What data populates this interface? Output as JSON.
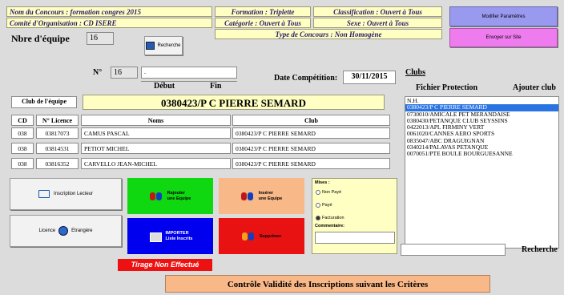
{
  "info": {
    "concours": "Nom du Concours : formation  congres  2015",
    "comite": "Comité d'Organisation : CD ISERE",
    "formation": "Formation : Triplette",
    "categorie": "Catégorie : Ouvert à Tous",
    "classification": "Classification : Ouvert à Tous",
    "sexe": "Sexe : Ouvert à Tous",
    "type": "Type de Concours : Non Homogène"
  },
  "buttons": {
    "modifier": "Modifier Paramètres",
    "envoyer": "Envoyer sur Site",
    "recherche_small": "Recherche",
    "inscription": "Inscription Lecteur",
    "licence": "Licence",
    "etrangere": "Etrangère",
    "rajouter": [
      "Rajouter",
      "une Equipe"
    ],
    "inserer": [
      "Insérer",
      "une Equipe"
    ],
    "importer": [
      "IMPORTER",
      "Liste Inscrits"
    ],
    "supprimer": "Supprimer",
    "fichier_protection": "Fichier Protection",
    "ajouter_club": "Ajouter club",
    "recherche": "Recherche",
    "controle": "Contrôle Validité des Inscriptions suivant les Critères"
  },
  "nbre": {
    "label": "Nbre d'équipe",
    "value": "16"
  },
  "numero": {
    "label": "N°",
    "value": "16",
    "debut": "Début",
    "fin": "Fin",
    "field": "."
  },
  "competition": {
    "label": "Date Compétition:",
    "value": "30/11/2015"
  },
  "team": {
    "club_label": "Club de l'équipe",
    "club_name": "0380423/P C PIERRE SEMARD"
  },
  "table": {
    "headers": [
      "CD",
      "N° Licence",
      "Noms",
      "Club"
    ],
    "rows": [
      [
        "038",
        "03817073",
        "CAMUS PASCAL",
        "0380423/P C PIERRE SEMARD"
      ],
      [
        "038",
        "03814531",
        "PETIOT MICHEL",
        "0380423/P C PIERRE SEMARD"
      ],
      [
        "038",
        "03816352",
        "CARVELLO JEAN-MICHEL",
        "0380423/P C PIERRE SEMARD"
      ]
    ]
  },
  "mises": {
    "label": "Mises :",
    "options": [
      "Non Payé",
      "Payé",
      "Facturation"
    ],
    "selected": "Facturation",
    "commentaire": "Commentaire:"
  },
  "tirage": "Tirage Non Effectué",
  "clubs": {
    "title": "Clubs",
    "selected": "0380423/P C PIERRE SEMARD",
    "items": [
      "N.H.",
      "0380423/P C PIERRE SEMARD",
      "0730010/AMICALE PET MERANDAISE",
      "0380430/PETANQUE CLUB SEYSSINS",
      "0422013/APL FIRMINY VERT",
      "0061020/CANNES AERO SPORTS",
      "0835047/ABC DRAGUIGNAN",
      "0340214/PALAVAS PETANQUE",
      "0070051/PTE BOULE BOURGUESANNE"
    ]
  },
  "colors": {
    "yellow_box": "#ffffc4",
    "modifier": "#9a99f0",
    "envoyer": "#ee7cee",
    "green": "#10d810",
    "orange": "#f8b888",
    "blue": "#0000ee",
    "red": "#e81212",
    "tirage": "#ee1111",
    "selected": "#2a74e2"
  }
}
